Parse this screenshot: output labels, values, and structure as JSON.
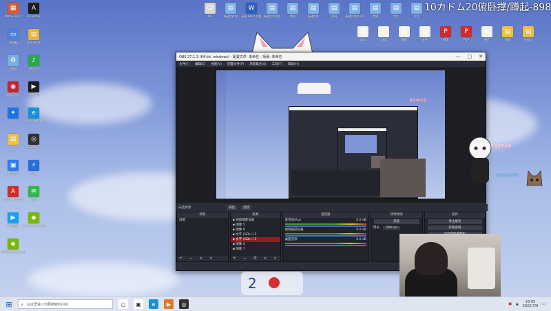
{
  "overlay": {
    "text": "10カドム20俯卧撑/蹲起-898"
  },
  "desktop_left": [
    {
      "label": "Motrix 20 PI",
      "color": "#e05a2a",
      "glyph": "▦"
    },
    {
      "label": "AI Gesture",
      "color": "#1d1d1d",
      "glyph": "A"
    },
    {
      "label": "此电脑",
      "color": "#4a86d8",
      "glyph": "▭"
    },
    {
      "label": "电子文件夹",
      "color": "#e3b341",
      "glyph": "▤"
    },
    {
      "label": "回收站",
      "color": "#7bb0e0",
      "glyph": "♻"
    },
    {
      "label": "QQ音乐",
      "color": "#2aa84a",
      "glyph": "♪"
    },
    {
      "label": "网易云音乐",
      "color": "#c8242a",
      "glyph": "◉"
    },
    {
      "label": "直播伴侣",
      "color": "#1e1e1e",
      "glyph": "▶"
    },
    {
      "label": "钉钉",
      "color": "#1f73e6",
      "glyph": "✦"
    },
    {
      "label": "Microsoft Edge",
      "color": "#1b8fd6",
      "glyph": "e"
    },
    {
      "label": "文档",
      "color": "#f0c040",
      "glyph": "▤"
    },
    {
      "label": "OBS Studio",
      "color": "#303030",
      "glyph": "◎"
    },
    {
      "label": "腾讯会议",
      "color": "#2f7cf0",
      "glyph": "▣"
    },
    {
      "label": "迅雷",
      "color": "#2a6fd8",
      "glyph": "⚡"
    },
    {
      "label": "Adobe Acrobat",
      "color": "#d22a2a",
      "glyph": "A"
    },
    {
      "label": "微信",
      "color": "#2fba4a",
      "glyph": "✉"
    },
    {
      "label": "腾讯视频",
      "color": "#1aa0f0",
      "glyph": "▶"
    },
    {
      "label": "GeForce Experience",
      "color": "#76b900",
      "glyph": "◆"
    },
    {
      "label": "NVIDIA Broadcast",
      "color": "#76b900",
      "glyph": "◆"
    }
  ],
  "desktop_top": [
    {
      "label": "Kai",
      "color": "#d6d6d6",
      "glyph": "☺"
    },
    {
      "label": "新建文件夹",
      "color": "#7fb0e8",
      "glyph": "▤"
    },
    {
      "label": "新建 Word 文档",
      "color": "#2b5fbf",
      "glyph": "W"
    },
    {
      "label": "新建文本文档",
      "color": "#7fb0e8",
      "glyph": "▤"
    },
    {
      "label": "素材",
      "color": "#7fb0e8",
      "glyph": "▤"
    },
    {
      "label": "新建文件",
      "color": "#7fb0e8",
      "glyph": "▤"
    },
    {
      "label": "资料",
      "color": "#7fb0e8",
      "glyph": "▤"
    },
    {
      "label": "新建文件夹 (2)",
      "color": "#7fb0e8",
      "glyph": "▤"
    },
    {
      "label": "剪辑",
      "color": "#7fb0e8",
      "glyph": "▤"
    },
    {
      "label": "工作",
      "color": "#7fb0e8",
      "glyph": "▤"
    },
    {
      "label": "文件",
      "color": "#7fb0e8",
      "glyph": "▤"
    }
  ],
  "desktop_right": [
    {
      "label": "文档1",
      "color": "#f2f2f2",
      "glyph": "▤"
    },
    {
      "label": "文档2",
      "color": "#f2f2f2",
      "glyph": "▤"
    },
    {
      "label": "表格",
      "color": "#f2f2f2",
      "glyph": "▤"
    },
    {
      "label": "文件",
      "color": "#f2f2f2",
      "glyph": "▤"
    },
    {
      "label": "PDF",
      "color": "#d22a2a",
      "glyph": "P"
    },
    {
      "label": "PDF",
      "color": "#d22a2a",
      "glyph": "P"
    },
    {
      "label": "图片",
      "color": "#f2f2f2",
      "glyph": "▤"
    },
    {
      "label": "表格",
      "color": "#f0c040",
      "glyph": "▤"
    },
    {
      "label": "压缩包",
      "color": "#f0c040",
      "glyph": "▤"
    }
  ],
  "obs": {
    "title": "OBS 27.1.3 (64-bit, windows) - 配置文件: 未命名 - 场景: 未命名",
    "window_controls": [
      "—",
      "□",
      "✕"
    ],
    "menu": [
      "文件(F)",
      "编辑(E)",
      "视图(V)",
      "配置文件(P)",
      "场景集合(S)",
      "工具(T)",
      "帮助(H)"
    ],
    "no_source": "未选择源",
    "properties_button": "属性",
    "filters_button": "滤镜",
    "docks": {
      "scenes": {
        "title": "场景",
        "items": [
          "场景"
        ]
      },
      "sources": {
        "title": "来源",
        "items": [
          "视频捕获设备",
          "图像 5",
          "图像 6",
          "文字 (GDI+) 2",
          "文字 (GDI+) 3",
          "图像 4",
          "图像 7"
        ],
        "selected_index": 4
      },
      "mixer": {
        "title": "混音器",
        "channels": [
          {
            "name": "麦克风/Aux",
            "db": "0.0 dB"
          },
          {
            "name": "视频捕获设备",
            "db": "0.0 dB"
          },
          {
            "name": "桌面音频",
            "db": "0.0 dB"
          }
        ]
      },
      "transitions": {
        "title": "转场特效",
        "type": "渐变",
        "duration_label": "时长",
        "duration": "300 ms"
      },
      "controls": {
        "title": "控件",
        "buttons": [
          "停止推流",
          "开始录制",
          "启动虚拟摄像机",
          "工作室模式",
          "设置",
          "退出"
        ]
      }
    },
    "status": "直播: 00:01:24   录制: 00:00:00   CPU: 4.1%, 30.00 fps"
  },
  "stickers": {
    "line1": "喜欢就点赞",
    "line2": "关注我不迷路",
    "line3": "DISCO HAPPY"
  },
  "taskbar": {
    "search_placeholder": "在这里输入你要搜索的内容",
    "clock_time": "16:05",
    "clock_date": "2022/7/9",
    "apps": [
      {
        "name": "cortana",
        "color": "#ffffff",
        "glyph": "○"
      },
      {
        "name": "task-view",
        "color": "#ffffff",
        "glyph": "▣"
      },
      {
        "name": "edge",
        "color": "#1b8fd6",
        "glyph": "e"
      },
      {
        "name": "orange-app",
        "color": "#e07a2a",
        "glyph": "▶"
      },
      {
        "name": "obs",
        "color": "#303030",
        "glyph": "◎"
      }
    ]
  }
}
